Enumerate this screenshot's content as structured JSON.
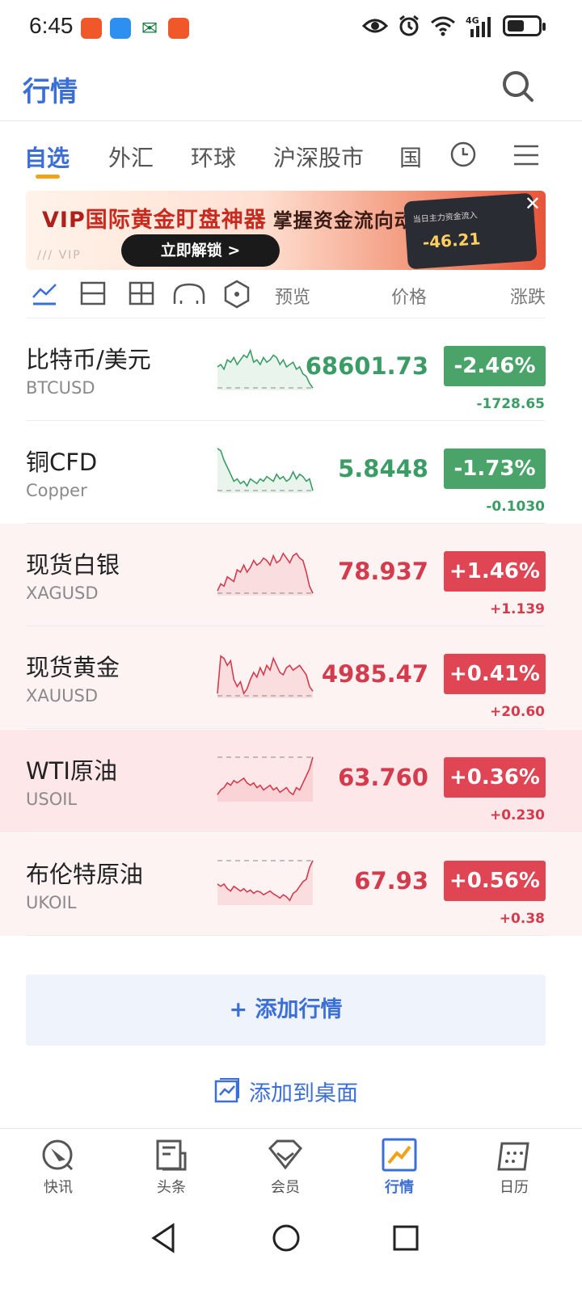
{
  "status_bar": {
    "time": "6:45",
    "app_icons": [
      "#f0582a",
      "#2d8ff0",
      "#0f7a3a",
      "#f0582a"
    ],
    "network": "4G"
  },
  "header": {
    "title": "行情"
  },
  "tabs": {
    "items": [
      "自选",
      "外汇",
      "环球",
      "沪深股市",
      "国"
    ],
    "active": "自选"
  },
  "banner": {
    "title_prefix": "VIP",
    "title_main": "国际黄金盯盘神器",
    "title_sub": "掌握资金流向动态",
    "button": "立即解锁  >",
    "watermark": "/// VIP",
    "phone_label": "当日主力资金流入",
    "phone_value": "-46.21"
  },
  "toolbar": {
    "preview_label": "预览",
    "price_label": "价格",
    "change_label": "涨跌"
  },
  "quotes": [
    {
      "name": "比特币/美元",
      "code": "BTCUSD",
      "price": "68601.73",
      "pct": "-2.46%",
      "change": "-1728.65",
      "dir": "down",
      "spark": [
        0.5,
        0.45,
        0.55,
        0.35,
        0.4,
        0.3,
        0.45,
        0.35,
        0.25,
        0.3,
        0.15,
        0.4,
        0.35,
        0.45,
        0.3,
        0.4,
        0.35,
        0.25,
        0.3,
        0.45,
        0.35,
        0.5,
        0.45,
        0.4,
        0.55,
        0.5,
        0.65,
        0.7,
        0.85,
        0.95
      ]
    },
    {
      "name": "铜CFD",
      "code": "Copper",
      "price": "5.8448",
      "pct": "-1.73%",
      "change": "-0.1030",
      "dir": "down",
      "spark": [
        0.05,
        0.1,
        0.3,
        0.45,
        0.6,
        0.75,
        0.7,
        0.8,
        0.75,
        0.85,
        0.7,
        0.75,
        0.8,
        0.7,
        0.75,
        0.65,
        0.7,
        0.75,
        0.6,
        0.7,
        0.65,
        0.75,
        0.7,
        0.55,
        0.7,
        0.6,
        0.65,
        0.75,
        0.7,
        0.95
      ]
    },
    {
      "name": "现货白银",
      "code": "XAGUSD",
      "price": "78.937",
      "pct": "+1.46%",
      "change": "+1.139",
      "dir": "up",
      "spark": [
        0.9,
        0.75,
        0.8,
        0.6,
        0.65,
        0.7,
        0.45,
        0.5,
        0.35,
        0.5,
        0.4,
        0.25,
        0.35,
        0.3,
        0.2,
        0.25,
        0.35,
        0.15,
        0.3,
        0.25,
        0.1,
        0.2,
        0.3,
        0.15,
        0.1,
        0.2,
        0.25,
        0.5,
        0.8,
        0.95
      ]
    },
    {
      "name": "现货黄金",
      "code": "XAUUSD",
      "price": "4985.47",
      "pct": "+0.41%",
      "change": "+20.60",
      "dir": "up",
      "spark": [
        0.9,
        0.1,
        0.15,
        0.3,
        0.2,
        0.6,
        0.75,
        0.65,
        0.9,
        0.8,
        0.6,
        0.45,
        0.55,
        0.35,
        0.5,
        0.3,
        0.4,
        0.15,
        0.3,
        0.45,
        0.5,
        0.35,
        0.3,
        0.4,
        0.35,
        0.3,
        0.4,
        0.5,
        0.75,
        0.85
      ]
    },
    {
      "name": "WTI原油",
      "code": "USOIL",
      "price": "63.760",
      "pct": "+0.36%",
      "change": "+0.230",
      "dir": "up",
      "highlight": true,
      "spark": [
        0.85,
        0.75,
        0.7,
        0.6,
        0.65,
        0.55,
        0.6,
        0.55,
        0.5,
        0.6,
        0.65,
        0.6,
        0.7,
        0.65,
        0.75,
        0.7,
        0.65,
        0.75,
        0.7,
        0.8,
        0.75,
        0.7,
        0.8,
        0.85,
        0.7,
        0.75,
        0.6,
        0.45,
        0.3,
        0.05
      ]
    },
    {
      "name": "布伦特原油",
      "code": "UKOIL",
      "price": "67.93",
      "pct": "+0.56%",
      "change": "+0.38",
      "dir": "up",
      "spark": [
        0.55,
        0.6,
        0.55,
        0.65,
        0.7,
        0.6,
        0.65,
        0.7,
        0.65,
        0.72,
        0.68,
        0.75,
        0.7,
        0.72,
        0.78,
        0.74,
        0.7,
        0.76,
        0.8,
        0.85,
        0.78,
        0.82,
        0.9,
        0.75,
        0.7,
        0.6,
        0.5,
        0.45,
        0.2,
        0.05
      ]
    }
  ],
  "add_quote": "+ 添加行情",
  "add_desktop": "添加到桌面",
  "bottom_nav": [
    {
      "label": "快讯",
      "icon": "newsflash-icon"
    },
    {
      "label": "头条",
      "icon": "headline-icon"
    },
    {
      "label": "会员",
      "icon": "vip-diamond-icon"
    },
    {
      "label": "行情",
      "icon": "market-chart-icon",
      "active": true
    },
    {
      "label": "日历",
      "icon": "calendar-icon"
    }
  ]
}
